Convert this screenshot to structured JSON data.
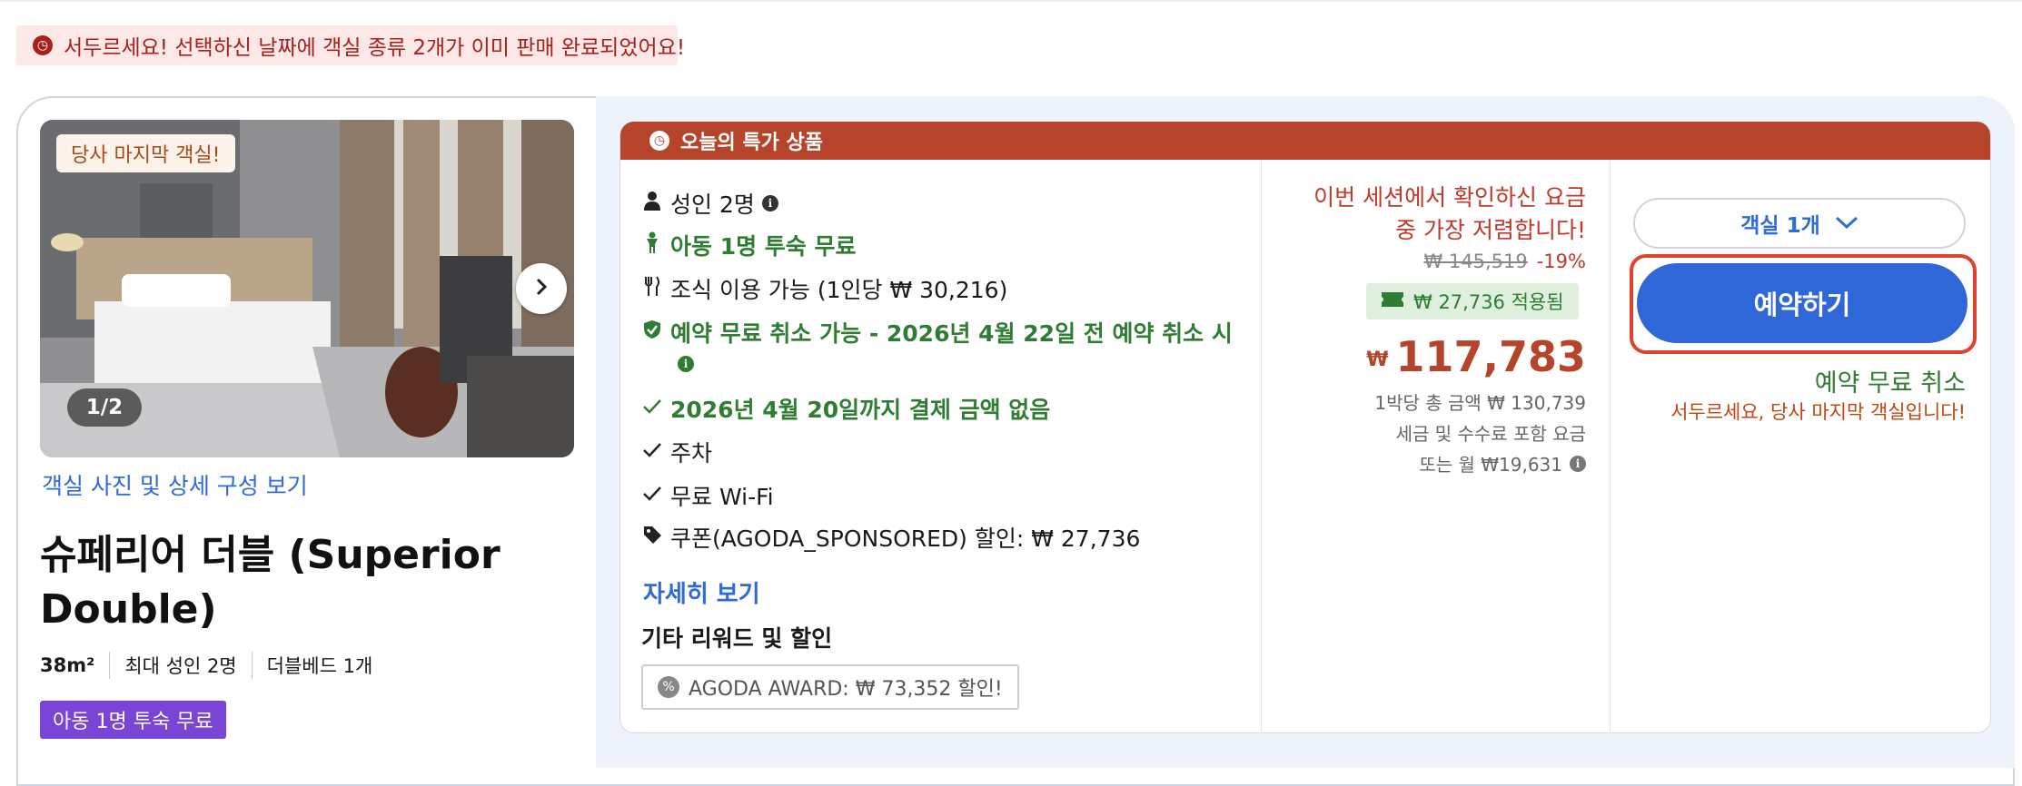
{
  "banner": {
    "text": "서두르세요! 선택하신 날짜에 객실 종류 2개가 이미 판매 완료되었어요!",
    "icon": "clock-icon"
  },
  "room": {
    "last_room_tag": "당사 마지막 객실!",
    "photo_counter": "1/2",
    "photo_link": "객실 사진 및 상세 구성 보기",
    "title": "슈페리어 더블 (Superior Double)",
    "specs": [
      "38m²",
      "최대 성인 2명",
      "더블베드 1개"
    ],
    "kid_badge": "아동 1명 투숙 무료"
  },
  "deal": {
    "header": "오늘의 특가 상품",
    "features": {
      "adults": "성인 2명",
      "kid": "아동 1명 투숙 무료",
      "breakfast": "조식 이용 가능 (1인당 ₩ 30,216)",
      "free_cancel": "예약 무료 취소 가능 - 2026년 4월 22일 전 예약 취소 시",
      "no_payment": "2026년 4월 20일까지 결제 금액 없음",
      "parking": "주차",
      "wifi": "무료 Wi-Fi",
      "coupon": "쿠폰(AGODA_SPONSORED) 할인: ₩ 27,736"
    },
    "more_link": "자세히 보기",
    "rewards_title": "기타 리워드 및 할인",
    "award": "AGODA AWARD: ₩ 73,352 할인!"
  },
  "price": {
    "cheapest_line1": "이번 세션에서 확인하신 요금",
    "cheapest_line2": "중 가장 저렴합니다!",
    "original": "₩ 145,519",
    "discount": "-19%",
    "coupon_applied": "₩ 27,736 적용됨",
    "currency": "₩",
    "amount": "117,783",
    "per_night": "1박당 총 금액 ₩ 130,739",
    "taxes": "세금 및 수수료 포함 요금",
    "monthly": "또는 월 ₩19,631"
  },
  "action": {
    "rooms_label": "객실 1개",
    "book_label": "예약하기",
    "free_cancel": "예약 무료 취소",
    "hurry": "서두르세요, 당사 마지막 객실입니다!"
  },
  "colors": {
    "accent_blue": "#2f66d8",
    "deal_red": "#b5442a",
    "success_green": "#2e7d32",
    "badge_purple": "#7a45d6",
    "highlight_red": "#e0432c"
  }
}
